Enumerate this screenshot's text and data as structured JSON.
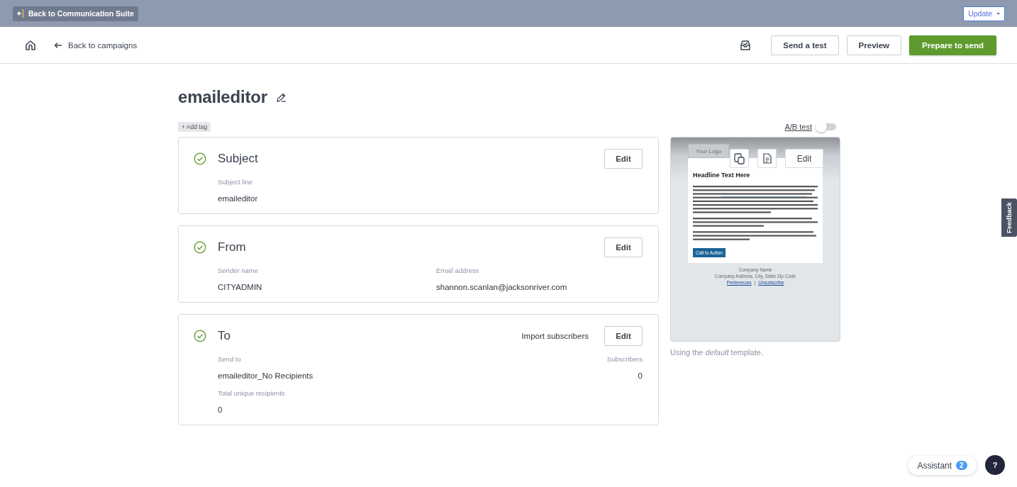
{
  "top_bar": {
    "back_button": "Back to Communication Suite",
    "update_button": "Update"
  },
  "header": {
    "back_link": "Back to campaigns",
    "buttons": [
      {
        "label": "Send a test",
        "kind": "secondary"
      },
      {
        "label": "Preview",
        "kind": "secondary"
      },
      {
        "label": "Prepare to send",
        "kind": "primary"
      }
    ]
  },
  "campaign": {
    "title": "emaileditor",
    "add_tag": "+ Add tag",
    "ab_test": {
      "label": "A/B test",
      "on": false
    }
  },
  "sections": [
    {
      "title": "Subject",
      "complete": true,
      "edit": "Edit",
      "rows": [
        [
          {
            "label": "Subject line",
            "value": "emaileditor",
            "kind": "text"
          }
        ]
      ]
    },
    {
      "title": "From",
      "complete": true,
      "edit": "Edit",
      "rows": [
        [
          {
            "label": "Sender name",
            "value": "CITYADMIN",
            "kind": "text"
          },
          {
            "label": "Email address",
            "value": "shannon.scanlan@jacksonriver.com",
            "kind": "text"
          }
        ]
      ]
    },
    {
      "title": "To",
      "complete": true,
      "edit": "Edit",
      "action": "Import subscribers",
      "rows": [
        [
          {
            "label": "Send to",
            "value": "emaileditor_No Recipients",
            "kind": "text"
          },
          {
            "label": "Subscribers",
            "value": "0",
            "kind": "count"
          }
        ],
        [
          {
            "label": "Total unique recipients",
            "value": "0",
            "kind": "text"
          }
        ]
      ]
    }
  ],
  "preview": {
    "logo": "Your Logo",
    "headline": "Headline Text Here",
    "cta": "Call to Action",
    "company_name": "Company Name",
    "company_address": "Company Address, City, State Zip Code",
    "links": [
      "Preferences",
      "Unsubscribe"
    ],
    "link_separator": "|",
    "edit": "Edit",
    "caption": "Using the *default* template."
  },
  "feedback": "Feedback",
  "assistant": {
    "label": "Assistant",
    "count": "2"
  },
  "help": "?"
}
